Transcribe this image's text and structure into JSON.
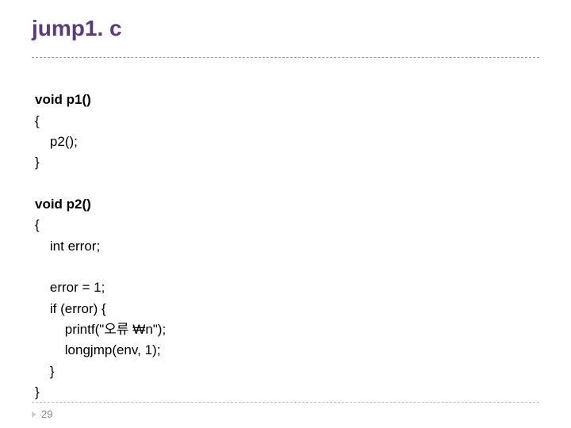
{
  "title": "jump1. c",
  "code": {
    "l1": "void p1()",
    "l2": "{",
    "l3": "    p2();",
    "l4": "}",
    "l5": "",
    "l6": "void p2()",
    "l7": "{",
    "l8": "    int error;",
    "l9": "",
    "l10": "    error = 1;",
    "l11": "    if (error) {",
    "l12": "        printf(\"오류 ₩n\");",
    "l13": "        longjmp(env, 1);",
    "l14": "    }",
    "l15": "}"
  },
  "slide_number": "29"
}
